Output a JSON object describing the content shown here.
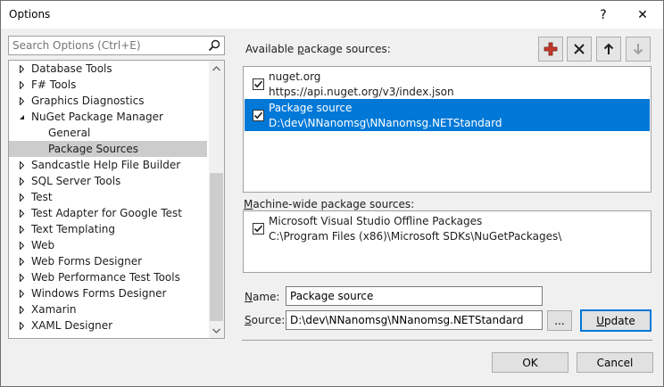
{
  "window": {
    "title": "Options",
    "help_glyph": "?",
    "close_glyph": "✕"
  },
  "search": {
    "placeholder": "Search Options (Ctrl+E)"
  },
  "tree": {
    "items": [
      {
        "label": "Database Tools",
        "expanded": false,
        "level": 0,
        "selected": false
      },
      {
        "label": "F# Tools",
        "expanded": false,
        "level": 0,
        "selected": false
      },
      {
        "label": "Graphics Diagnostics",
        "expanded": false,
        "level": 0,
        "selected": false
      },
      {
        "label": "NuGet Package Manager",
        "expanded": true,
        "level": 0,
        "selected": false
      },
      {
        "label": "General",
        "expanded": null,
        "level": 1,
        "selected": false
      },
      {
        "label": "Package Sources",
        "expanded": null,
        "level": 1,
        "selected": true
      },
      {
        "label": "Sandcastle Help File Builder",
        "expanded": false,
        "level": 0,
        "selected": false
      },
      {
        "label": "SQL Server Tools",
        "expanded": false,
        "level": 0,
        "selected": false
      },
      {
        "label": "Test",
        "expanded": false,
        "level": 0,
        "selected": false
      },
      {
        "label": "Test Adapter for Google Test",
        "expanded": false,
        "level": 0,
        "selected": false
      },
      {
        "label": "Text Templating",
        "expanded": false,
        "level": 0,
        "selected": false
      },
      {
        "label": "Web",
        "expanded": false,
        "level": 0,
        "selected": false
      },
      {
        "label": "Web Forms Designer",
        "expanded": false,
        "level": 0,
        "selected": false
      },
      {
        "label": "Web Performance Test Tools",
        "expanded": false,
        "level": 0,
        "selected": false
      },
      {
        "label": "Windows Forms Designer",
        "expanded": false,
        "level": 0,
        "selected": false
      },
      {
        "label": "Xamarin",
        "expanded": false,
        "level": 0,
        "selected": false
      },
      {
        "label": "XAML Designer",
        "expanded": false,
        "level": 0,
        "selected": false
      }
    ]
  },
  "available": {
    "label_before": "Available ",
    "label_accel": "p",
    "label_after": "ackage sources:",
    "sources": [
      {
        "name": "nuget.org",
        "url": "https://api.nuget.org/v3/index.json",
        "checked": true,
        "selected": false
      },
      {
        "name": "Package source",
        "url": "D:\\dev\\NNanomsg\\NNanomsg.NETStandard",
        "checked": true,
        "selected": true
      }
    ]
  },
  "machine_wide": {
    "label_accel": "M",
    "label_after": "achine-wide package sources:",
    "sources": [
      {
        "name": "Microsoft Visual Studio Offline Packages",
        "url": "C:\\Program Files (x86)\\Microsoft SDKs\\NuGetPackages\\",
        "checked": true
      }
    ]
  },
  "toolbar": {
    "add": "add-icon",
    "remove": "remove-icon",
    "up": "arrow-up-icon",
    "down": "arrow-down-icon"
  },
  "form": {
    "name_accel": "N",
    "name_after": "ame:",
    "name_value": "Package source",
    "source_accel": "S",
    "source_after": "ource:",
    "source_value": "D:\\dev\\NNanomsg\\NNanomsg.NETStandard",
    "browse_label": "...",
    "update_accel": "U",
    "update_after": "pdate"
  },
  "footer": {
    "ok_label": "OK",
    "cancel_label": "Cancel"
  },
  "colors": {
    "selection": "#0078d7",
    "tree_selection": "#cccccc",
    "add_icon": "#c2392b"
  }
}
